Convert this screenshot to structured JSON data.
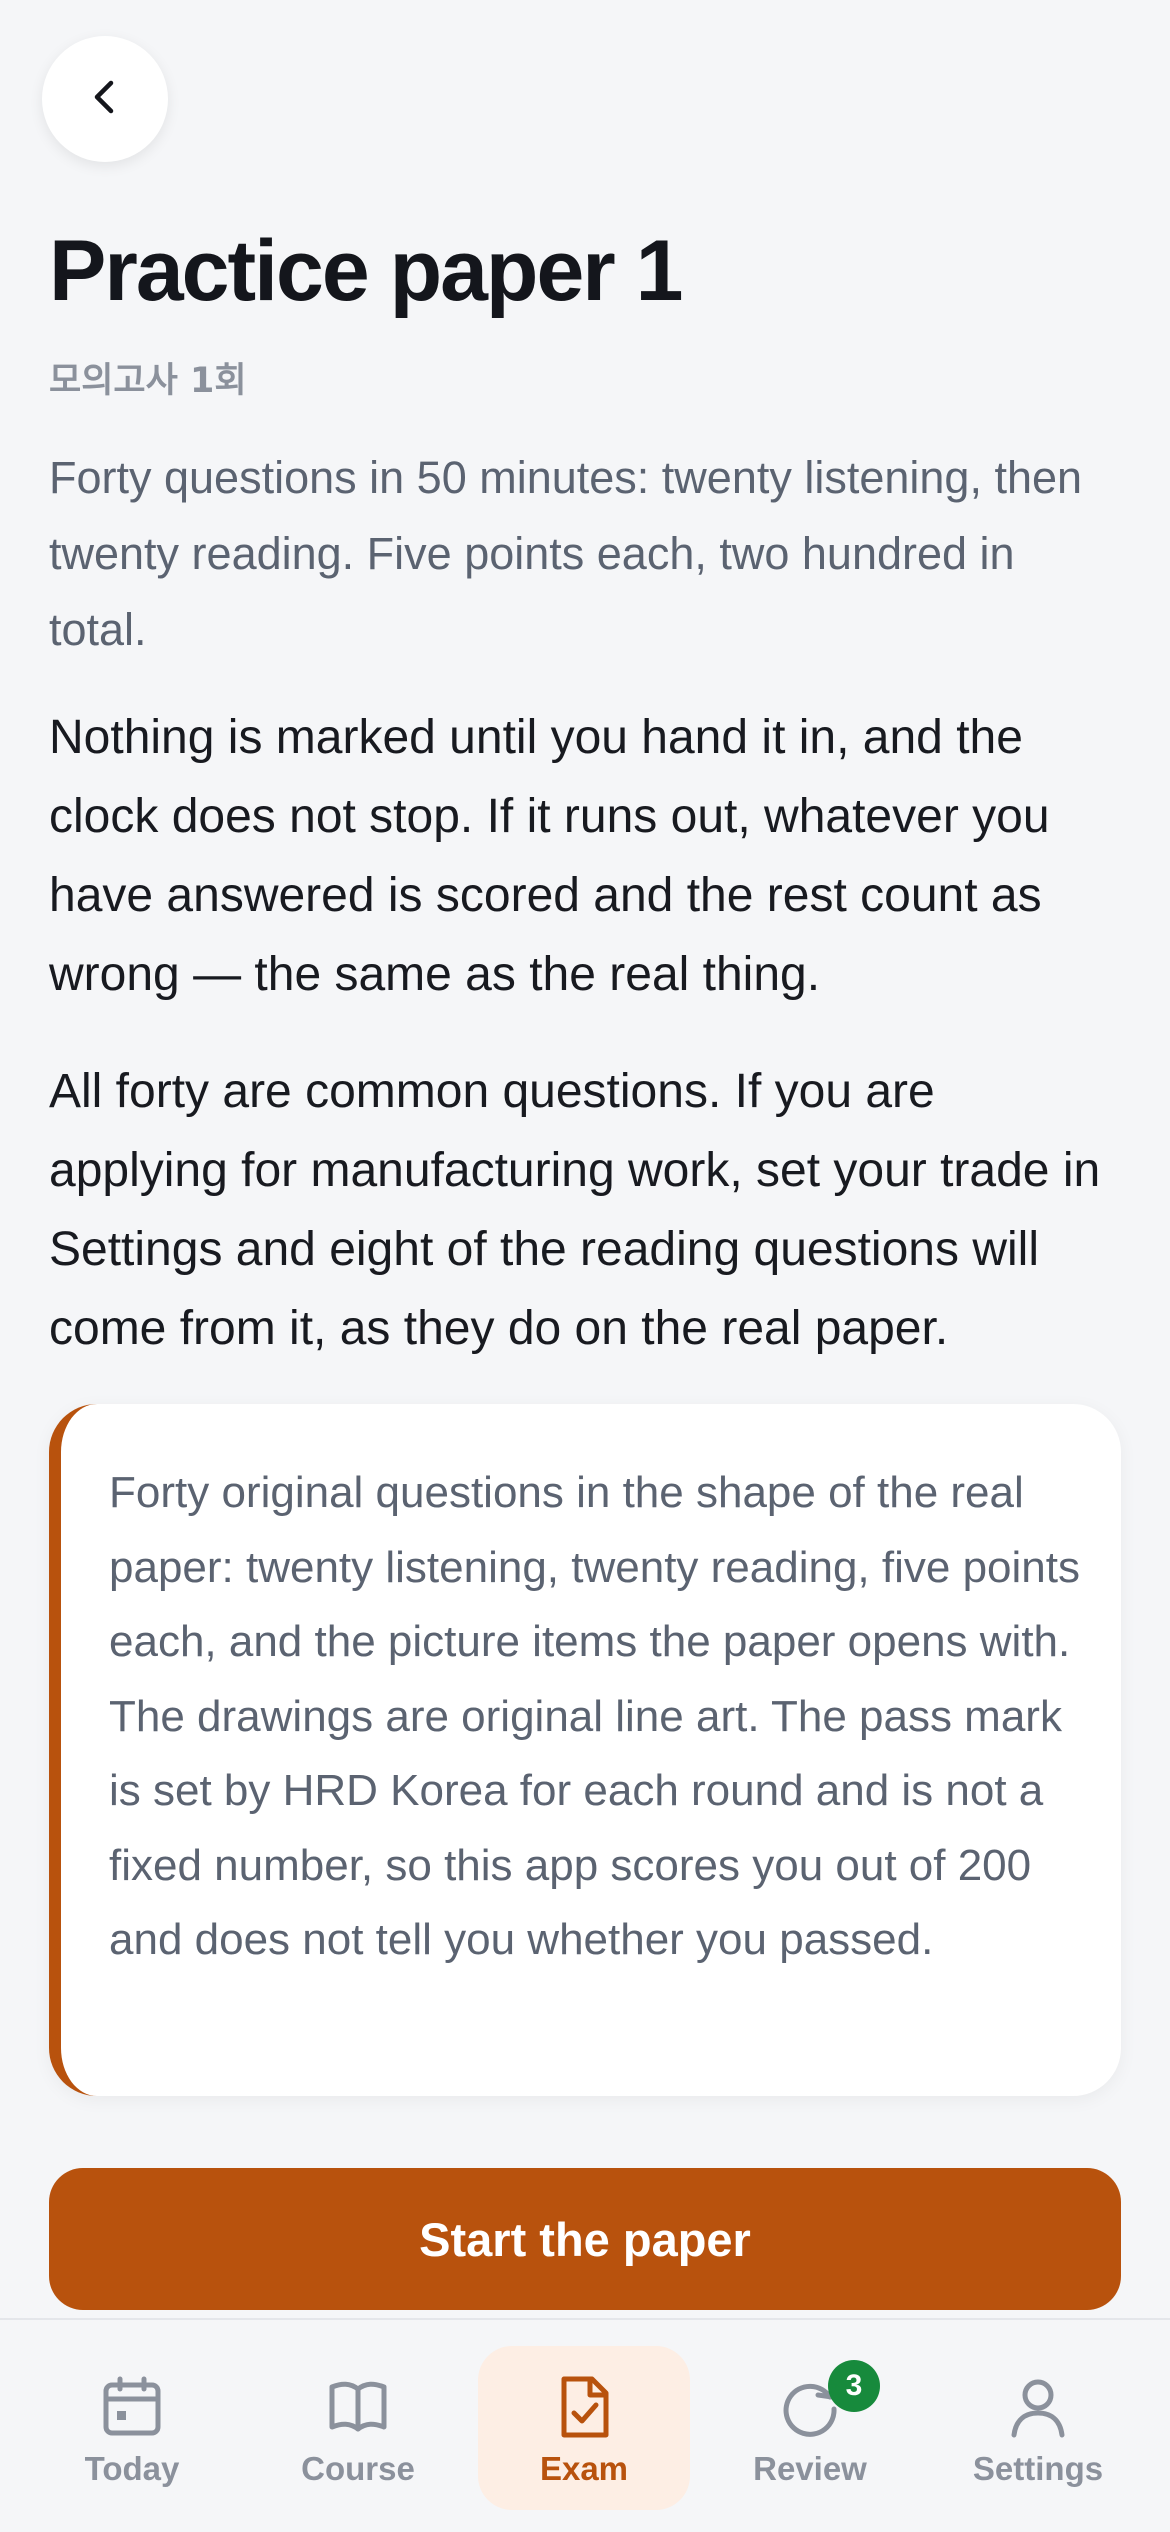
{
  "header": {
    "back_icon": "chevron-left-icon",
    "title": "Practice paper 1",
    "subtitle": "모의고사 1회"
  },
  "intro": "Forty questions in 50 minutes: twenty listening, then twenty reading. Five points each, two hundred in total.",
  "paragraphs": [
    "Nothing is marked until you hand it in, and the clock does not stop. If it runs out, whatever you have answered is scored and the rest count as wrong — the same as the real thing.",
    "All forty are common questions. If you are applying for manufacturing work, set your trade in Settings and eight of the reading questions will come from it, as they do on the real paper."
  ],
  "note": "Forty original questions in the shape of the real paper: twenty listening, twenty reading, five points each, and the picture items the paper opens with. The drawings are original line art. The pass mark is set by HRD Korea for each round and is not a fixed number, so this app scores you out of 200 and does not tell you whether you passed.",
  "start_button": "Start the paper",
  "tabs": [
    {
      "label": "Today",
      "icon": "calendar-icon",
      "active": false
    },
    {
      "label": "Course",
      "icon": "book-icon",
      "active": false
    },
    {
      "label": "Exam",
      "icon": "document-check-icon",
      "active": true
    },
    {
      "label": "Review",
      "icon": "refresh-icon",
      "active": false,
      "badge": "3"
    },
    {
      "label": "Settings",
      "icon": "person-icon",
      "active": false
    }
  ],
  "colors": {
    "accent": "#b8520d",
    "accent_soft": "#fdeee4",
    "badge": "#178a3c",
    "muted": "#8b919c",
    "background": "#f5f6f8"
  }
}
